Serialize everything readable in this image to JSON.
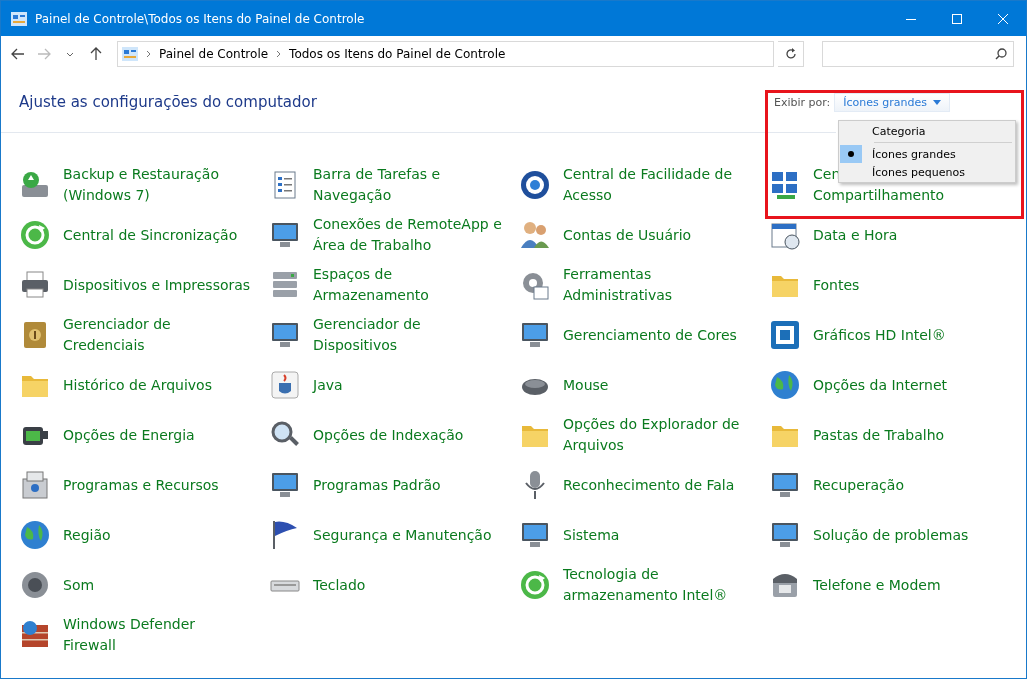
{
  "window": {
    "title": "Painel de Controle\\Todos os Itens do Painel de Controle"
  },
  "address": {
    "crumbs": [
      "Painel de Controle",
      "Todos os Itens do Painel de Controle"
    ]
  },
  "heading": "Ajuste as configurações do computador",
  "view_by": {
    "label": "Exibir por:",
    "value": "Ícones grandes",
    "expanded": true
  },
  "view_menu": [
    {
      "label": "Categoria",
      "selected": false
    },
    {
      "label": "Ícones grandes",
      "selected": true
    },
    {
      "label": "Ícones pequenos",
      "selected": false
    }
  ],
  "items": [
    {
      "lines": [
        "Backup e Restauração",
        "(Windows 7)"
      ]
    },
    {
      "lines": [
        "Barra de Tarefas e",
        "Navegação"
      ]
    },
    {
      "lines": [
        "Central de Facilidade de",
        "Acesso"
      ]
    },
    {
      "lines": [
        "Cen",
        "Compartilhamento"
      ]
    },
    {
      "lines": [
        "Central de Sincronização"
      ]
    },
    {
      "lines": [
        "Conexões de RemoteApp e",
        "Área de Trabalho"
      ]
    },
    {
      "lines": [
        "Contas de Usuário"
      ]
    },
    {
      "lines": [
        "Data e Hora"
      ]
    },
    {
      "lines": [
        "Dispositivos e Impressoras"
      ]
    },
    {
      "lines": [
        "Espaços de",
        "Armazenamento"
      ]
    },
    {
      "lines": [
        "Ferramentas",
        "Administrativas"
      ]
    },
    {
      "lines": [
        "Fontes"
      ]
    },
    {
      "lines": [
        "Gerenciador de",
        "Credenciais"
      ]
    },
    {
      "lines": [
        "Gerenciador de",
        "Dispositivos"
      ]
    },
    {
      "lines": [
        "Gerenciamento de Cores"
      ]
    },
    {
      "lines": [
        "Gráficos HD Intel®"
      ]
    },
    {
      "lines": [
        "Histórico de Arquivos"
      ]
    },
    {
      "lines": [
        "Java"
      ]
    },
    {
      "lines": [
        "Mouse"
      ]
    },
    {
      "lines": [
        "Opções da Internet"
      ]
    },
    {
      "lines": [
        "Opções de Energia"
      ]
    },
    {
      "lines": [
        "Opções de Indexação"
      ]
    },
    {
      "lines": [
        "Opções do Explorador de",
        "Arquivos"
      ]
    },
    {
      "lines": [
        "Pastas de Trabalho"
      ]
    },
    {
      "lines": [
        "Programas e Recursos"
      ]
    },
    {
      "lines": [
        "Programas Padrão"
      ]
    },
    {
      "lines": [
        "Reconhecimento de Fala"
      ]
    },
    {
      "lines": [
        "Recuperação"
      ]
    },
    {
      "lines": [
        "Região"
      ]
    },
    {
      "lines": [
        "Segurança e Manutenção"
      ]
    },
    {
      "lines": [
        "Sistema"
      ]
    },
    {
      "lines": [
        "Solução de problemas"
      ]
    },
    {
      "lines": [
        "Som"
      ]
    },
    {
      "lines": [
        "Teclado"
      ]
    },
    {
      "lines": [
        "Tecnologia de",
        "armazenamento Intel®"
      ]
    },
    {
      "lines": [
        "Telefone e Modem"
      ]
    },
    {
      "lines": [
        "Windows Defender",
        "Firewall"
      ]
    }
  ]
}
